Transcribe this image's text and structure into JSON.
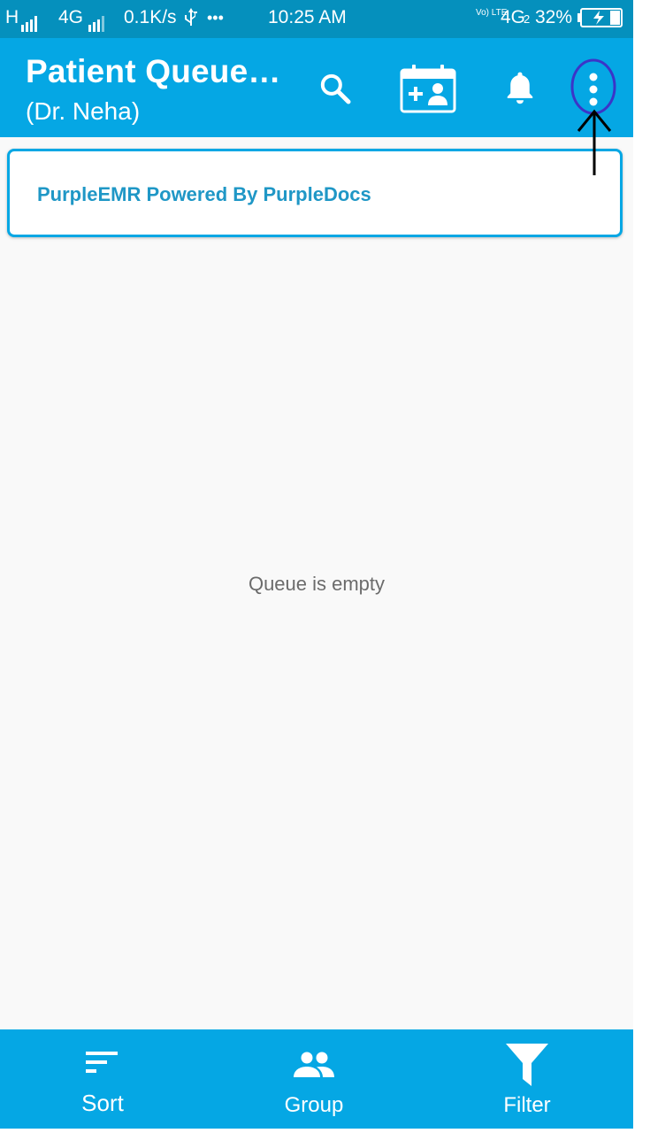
{
  "status_bar": {
    "network_1": "H",
    "network_2": "4G",
    "speed": "0.1K/s",
    "usb_icon": "usb-icon",
    "more_dots": "•••",
    "time": "10:25 AM",
    "volte": "Vo) LTE",
    "network_3": "4G",
    "sim_slot": "2",
    "battery_percent": "32%"
  },
  "app_bar": {
    "title": "Patient Queue…",
    "subtitle": "(Dr. Neha)",
    "icons": [
      "search-icon",
      "add-patient-calendar-icon",
      "bell-icon",
      "more-vert-icon"
    ]
  },
  "banner": {
    "text": "PurpleEMR Powered By PurpleDocs"
  },
  "main": {
    "empty_message": "Queue is empty"
  },
  "bottom_nav": {
    "items": [
      {
        "label": "Sort",
        "icon": "sort-icon"
      },
      {
        "label": "Group",
        "icon": "group-icon"
      },
      {
        "label": "Filter",
        "icon": "filter-icon"
      }
    ]
  },
  "colors": {
    "status_bar": "#0590bd",
    "primary": "#05a7e4",
    "banner_text": "#1f97c6",
    "background": "#f9f9f9",
    "annotation_circle": "#3b35c8"
  }
}
